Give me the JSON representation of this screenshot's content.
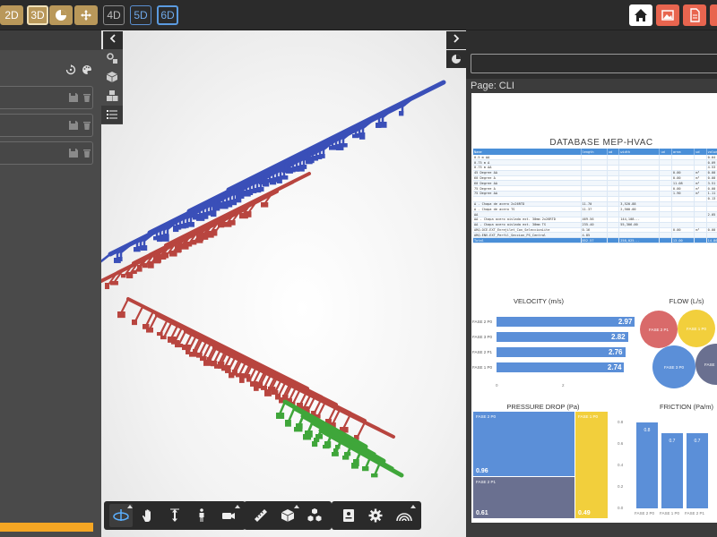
{
  "toolbar": {
    "dims": [
      {
        "label": "2D",
        "style": "gold"
      },
      {
        "label": "3D",
        "style": "gold-active"
      },
      {
        "label": "4D",
        "style": "outline-grey"
      },
      {
        "label": "5D",
        "style": "outline-blue"
      },
      {
        "label": "6D",
        "style": "outline-blue-selected"
      }
    ],
    "tools": [
      "pie-chart-icon",
      "move-arrows-icon"
    ],
    "right_buttons": [
      {
        "name": "home-icon",
        "color": "#ffffff"
      },
      {
        "name": "image-report-icon",
        "color": "#e8654f"
      },
      {
        "name": "pdf-report-icon",
        "color": "#e8654f"
      }
    ]
  },
  "left_panel": {
    "header_icons": [
      "reset-icon",
      "palette-icon"
    ],
    "rows": [
      {
        "icons": [
          "save-icon",
          "trash-icon"
        ]
      },
      {
        "icons": [
          "save-icon",
          "trash-icon"
        ]
      },
      {
        "icons": [
          "save-icon",
          "trash-icon"
        ]
      }
    ],
    "accent_color": "#f5a623"
  },
  "side_icons": [
    "settings-cubes-icon",
    "cube-icon",
    "cubes-icon",
    "list-icon"
  ],
  "bottom_toolbar": {
    "group1": [
      "orbit-icon",
      "hand-pan-icon",
      "vertical-move-icon",
      "walk-person-icon",
      "camera-icon"
    ],
    "group2": [
      "measure-ruler-icon",
      "section-box-icon",
      "explode-cubes-icon"
    ],
    "group3": [
      "properties-panel-icon",
      "settings-gear-icon"
    ],
    "group4": [
      "rainbow-icon"
    ]
  },
  "right_panel": {
    "tab_icon": "pie-chart-icon",
    "page_label": "Page: CLI",
    "report": {
      "title": "DATABASE MEP-HVAC",
      "table": {
        "headers": [
          "Name",
          "length",
          "ud",
          "width",
          "ud",
          "area",
          "ud",
          "volume"
        ],
        "rows": [
          [
            "0.5 m ΔΔ",
            "",
            "",
            "",
            "",
            "",
            "",
            "0.04"
          ],
          [
            "0.75 m Δ",
            "",
            "",
            "",
            "",
            "",
            "",
            "0.09"
          ],
          [
            "0.75 m ΔΔ",
            "",
            "",
            "",
            "",
            "",
            "",
            "4.53"
          ],
          [
            "45 Degree ΔΔ",
            "",
            "",
            "",
            "",
            "0.00",
            "m²",
            "0.00"
          ],
          [
            "60 Degree Δ",
            "",
            "",
            "",
            "",
            "0.00",
            "m²",
            "0.00"
          ],
          [
            "60 Degree ΔΔ",
            "",
            "",
            "",
            "",
            "11.08",
            "m²",
            "3.51"
          ],
          [
            "75 Degree Δ",
            "",
            "",
            "",
            "",
            "0.00",
            "m²",
            "0.00"
          ],
          [
            "75 Degree ΔΔ",
            "",
            "",
            "",
            "",
            "1.90",
            "m²",
            "1.11"
          ],
          [
            "",
            "",
            "",
            "",
            "",
            "",
            "",
            "0.13"
          ],
          [
            "Δ - Chapa de acero 2x26RTD",
            "11.70",
            "",
            "3,520.88",
            "",
            "",
            "",
            ""
          ],
          [
            "Δ - Chapa de acero TS",
            "11.37",
            "",
            "2,500.00",
            "",
            "",
            "",
            ""
          ],
          [
            "ΔΔ",
            "",
            "",
            "",
            "",
            "",
            "",
            "2.05"
          ],
          [
            "ΔΔ - Chapa acero aislada ext. 30mm 2x26RTD",
            "469.56",
            "",
            "144,108...",
            "",
            "",
            "",
            ""
          ],
          [
            "ΔΔ - Chapa acero aislada ext. 30mm TS",
            "235.40",
            "",
            "55,306.00",
            "",
            "",
            "",
            ""
          ],
          [
            "ARQ-OCE-EXT_Enrejilet_Con_SeleccionLite",
            "0.16",
            "",
            "",
            "",
            "0.00",
            "m²",
            "0.00"
          ],
          [
            "ARQ-ENV-EXT_Perfil_Seccion_PS_Central",
            "4.85",
            "",
            "",
            "",
            "",
            "",
            ""
          ]
        ],
        "total": [
          "Total",
          "852.57",
          "",
          "258,025...",
          "",
          "13.00",
          "",
          "14.86"
        ]
      },
      "velocity": {
        "title": "VELOCITY (m/s)",
        "axis": [
          "0",
          "2"
        ],
        "type": "bar",
        "categories": [
          "FASE 2 P0",
          "FASE 3 P0",
          "FASE 2 P1",
          "FASE 1 P0"
        ],
        "values": [
          2.97,
          2.82,
          2.76,
          2.74
        ],
        "value_labels": [
          "2.97",
          "2.82",
          "2.76",
          "2.74"
        ]
      },
      "flow": {
        "title": "FLOW (L/s)",
        "circles": [
          {
            "label": "FASE 2 P1",
            "color": "#d96a6a"
          },
          {
            "label": "FASE 1 P0",
            "color": "#f2cf3c"
          },
          {
            "label": "FASE 3 P0",
            "color": "#5b8fd8"
          },
          {
            "label": "FASE",
            "color": "#6a7090"
          }
        ]
      },
      "pressure_drop": {
        "title": "PRESSURE DROP (Pa)",
        "tiles": [
          {
            "label": "FASE 2 P0",
            "value": "0.96",
            "color": "#5b8fd8"
          },
          {
            "label": "FASE 2 P1",
            "value": "0.61",
            "color": "#6a7090"
          },
          {
            "label": "FASE 1 P0",
            "value": "0.49",
            "color": "#f2cf3c"
          }
        ]
      },
      "friction": {
        "title": "FRICTION (Pa/m)",
        "type": "bar",
        "axis": [
          "0.8",
          "0.6",
          "0.4",
          "0.2",
          "0.0"
        ],
        "ylim": [
          0,
          0.8
        ],
        "categories": [
          "FASE 2 P0",
          "FASE 1 P0",
          "FASE 2 P1"
        ],
        "values": [
          0.8,
          0.7,
          0.7
        ],
        "value_labels": [
          "0.8",
          "0.7",
          "0.7"
        ]
      }
    }
  },
  "chart_data": [
    {
      "type": "bar",
      "title": "VELOCITY (m/s)",
      "categories": [
        "FASE 2 P0",
        "FASE 3 P0",
        "FASE 2 P1",
        "FASE 1 P0"
      ],
      "values": [
        2.97,
        2.82,
        2.76,
        2.74
      ],
      "orientation": "horizontal"
    },
    {
      "type": "bar",
      "title": "FRICTION (Pa/m)",
      "categories": [
        "FASE 2 P0",
        "FASE 1 P0",
        "FASE 2 P1"
      ],
      "values": [
        0.8,
        0.7,
        0.7
      ],
      "ylim": [
        0,
        0.8
      ]
    },
    {
      "type": "heatmap",
      "title": "PRESSURE DROP (Pa)",
      "categories": [
        "FASE 2 P0",
        "FASE 2 P1",
        "FASE 1 P0"
      ],
      "values": [
        0.96,
        0.61,
        0.49
      ]
    }
  ],
  "model_colors": {
    "supply": "#3a4fb8",
    "return": "#b8453f",
    "exhaust": "#3fa63a"
  }
}
